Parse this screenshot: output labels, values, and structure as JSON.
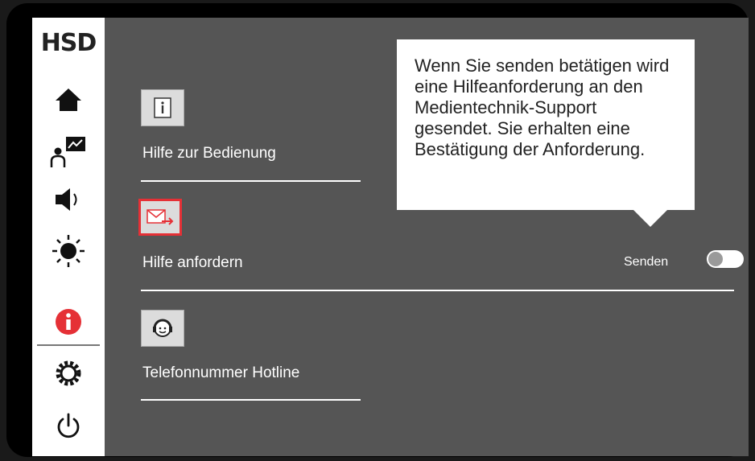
{
  "sidebar": {
    "logo": "HSD",
    "items": [
      {
        "name": "home-icon"
      },
      {
        "name": "presenter-icon"
      },
      {
        "name": "speaker-icon"
      },
      {
        "name": "brightness-icon"
      },
      {
        "name": "info-icon"
      },
      {
        "name": "settings-icon"
      },
      {
        "name": "power-icon"
      }
    ],
    "active_color": "#e53036"
  },
  "main": {
    "items": [
      {
        "label": "Hilfe zur Bedienung",
        "icon": "info-document-icon"
      },
      {
        "label": "Hilfe anfordern",
        "icon": "send-mail-icon"
      },
      {
        "label": "Telefonnummer Hotline",
        "icon": "headset-icon"
      }
    ],
    "tooltip": {
      "text": "Wenn Sie senden betätigen wird eine Hilfeanforderung an den Medientechnik-Support gesendet. Sie erhalten eine Bestätigung der Anforderung."
    },
    "send": {
      "label": "Senden",
      "toggle_on": false
    }
  }
}
